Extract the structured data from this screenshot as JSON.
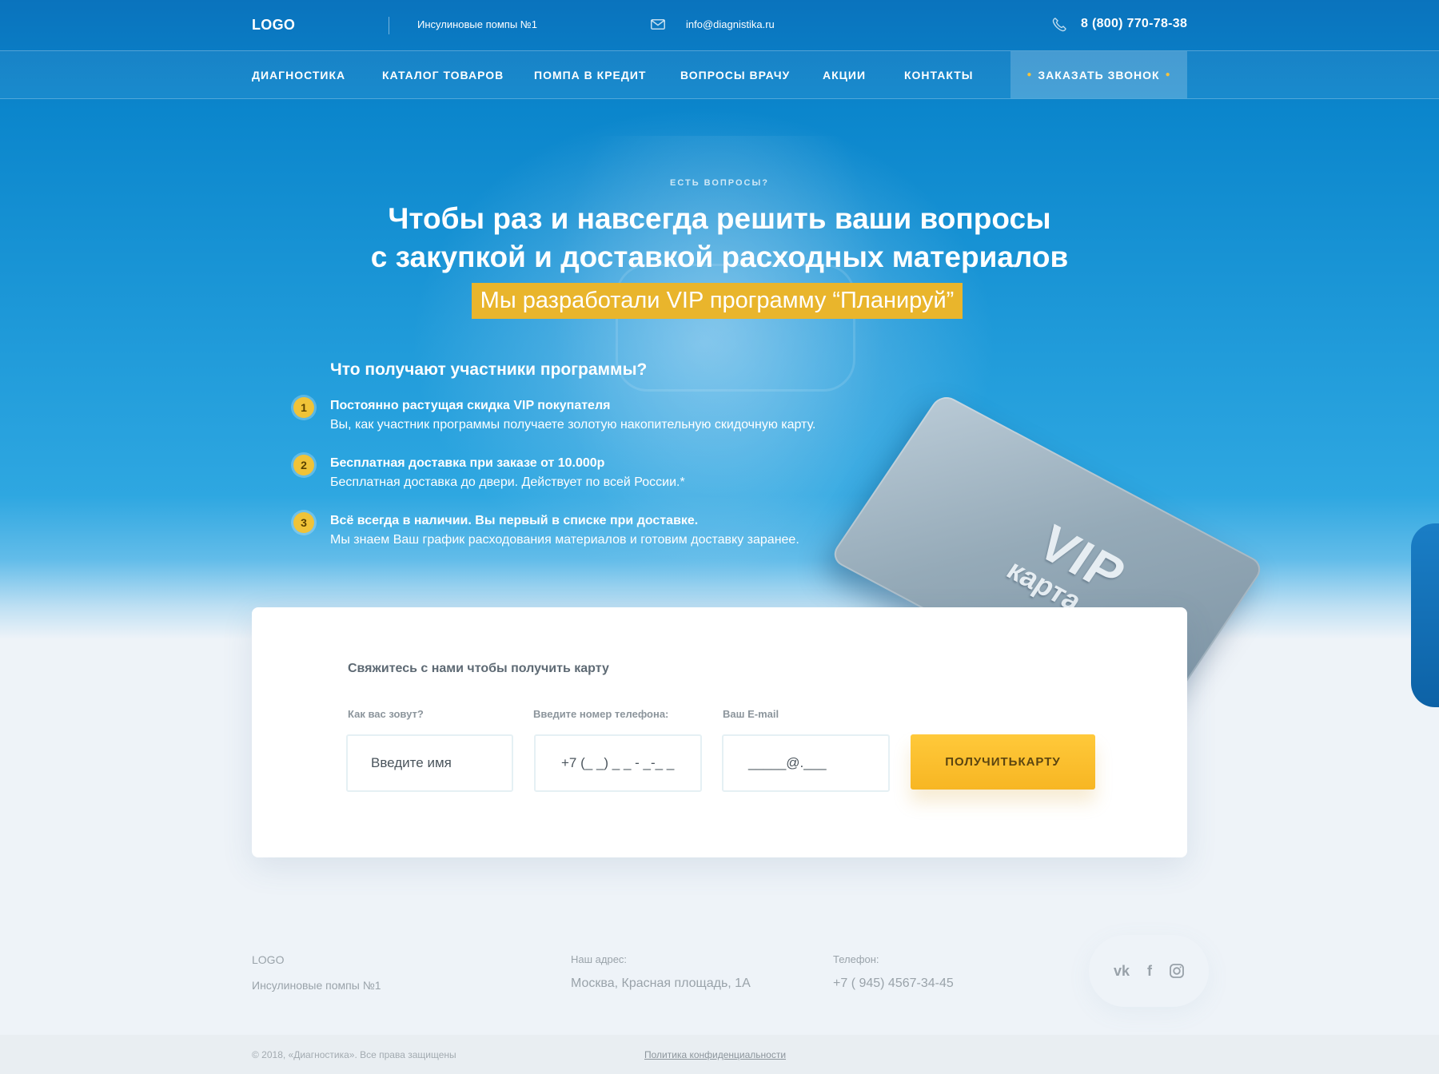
{
  "header": {
    "logo": "LOGO",
    "tagline": "Инсулиновые помпы №1",
    "email": "info@diagnistika.ru",
    "phone": "8 (800) 770-78-38",
    "icons": {
      "mail": "mail-icon",
      "phone": "phone-icon"
    }
  },
  "nav": {
    "items": [
      "ДИАГНОСТИКА",
      "КАТАЛОГ ТОВАРОВ",
      "ПОМПА В КРЕДИТ",
      "ВОПРОСЫ ВРАЧУ",
      "АКЦИИ",
      "КОНТАКТЫ"
    ],
    "cta": "ЗАКАЗАТЬ ЗВОНОК"
  },
  "hero": {
    "eyebrow": "ЕСТЬ ВОПРОСЫ?",
    "headline_line1": "Чтобы раз и навсегда решить ваши вопросы",
    "headline_line2": "с закупкой и доставкой расходных материалов",
    "highlight": "Мы разработали VIP программу “Планируй”",
    "benefits_title": "Что получают участники программы?",
    "benefits": [
      {
        "num": "1",
        "title": "Постоянно растущая скидка VIP покупателя",
        "text": "Вы, как участник программы получаете золотую накопительную скидочную карту."
      },
      {
        "num": "2",
        "title": "Бесплатная доставка при заказе от 10.000р",
        "text": "Бесплатная доставка до двери. Действует по всей России.*"
      },
      {
        "num": "3",
        "title": "Всё всегда в наличии. Вы первый в списке при доставке.",
        "text": "Мы знаем Ваш график расходования материалов и готовим доставку заранее."
      }
    ],
    "card_main": "VIP",
    "card_sub": "карта"
  },
  "form": {
    "title": "Свяжитесь с нами чтобы получить карту",
    "name_label": "Как вас зовут?",
    "name_placeholder": "Введите имя",
    "phone_label": "Введите номер телефона:",
    "phone_placeholder": "+7 (_ _) _ _ - _-_ _",
    "email_label": "Ваш E-mail",
    "email_placeholder": "_____@.___",
    "submit": "ПОЛУЧИТЬКАРТУ"
  },
  "footer": {
    "logo": "LOGO",
    "tagline": "Инсулиновые помпы №1",
    "address_label": "Наш адрес:",
    "address": "Москва, Красная площадь, 1А",
    "phone_label": "Телефон:",
    "phone": "+7 ( 945) 4567-34-45",
    "social": [
      "vk-icon",
      "facebook-icon",
      "instagram-icon"
    ],
    "copyright": "© 2018, «Диагностика». Все права защищены",
    "privacy": "Политика конфиденциальности"
  },
  "colors": {
    "accent_yellow": "#f7b623",
    "brand_blue": "#0b86cc"
  }
}
